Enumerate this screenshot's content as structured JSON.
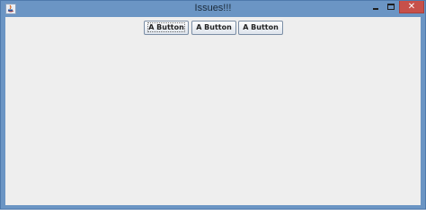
{
  "window": {
    "title": "Issues!!!",
    "close_glyph": "✕",
    "icons": {
      "app": "java-app-icon",
      "minimize": "minimize-icon",
      "maximize": "maximize-icon",
      "close": "close-icon"
    }
  },
  "panel": {
    "buttons": [
      {
        "label": "A Button"
      },
      {
        "label": "A Button"
      },
      {
        "label": "A Button"
      }
    ]
  },
  "colors": {
    "titlebar": "#6b95c4",
    "close": "#c7504a",
    "client_bg": "#eeeeee"
  }
}
